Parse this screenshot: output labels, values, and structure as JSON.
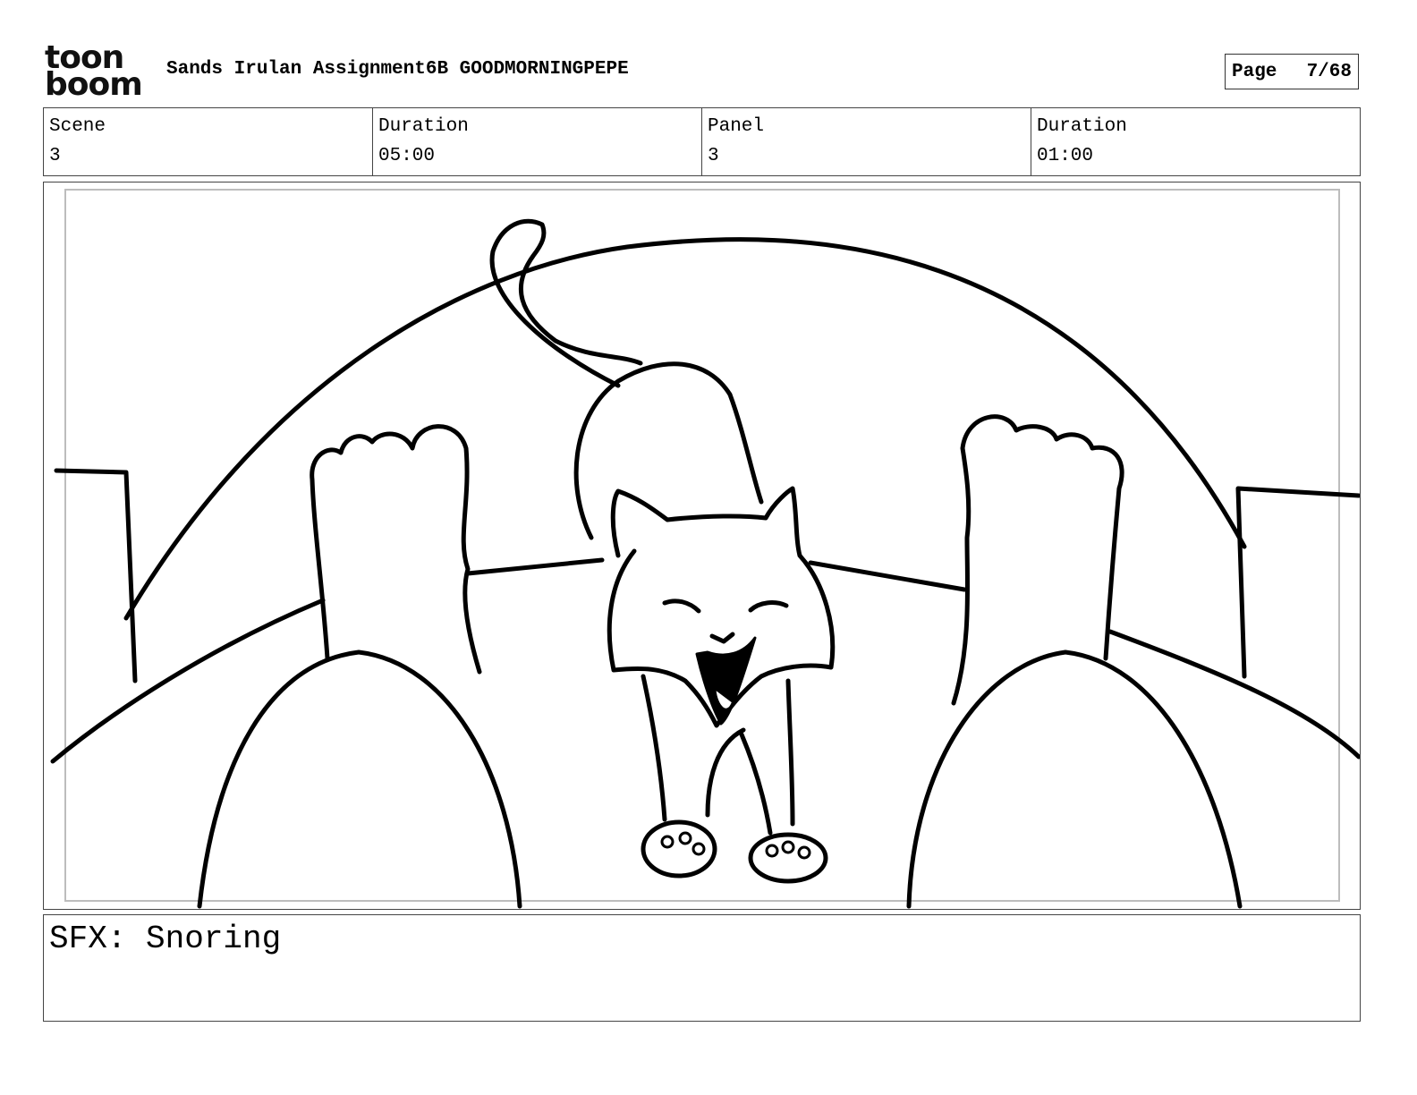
{
  "header": {
    "logo_top": "toon",
    "logo_bottom": "boom",
    "title": "Sands Irulan Assignment6B GOODMORNINGPEPE",
    "page_label": "Page",
    "page_value": "7/68"
  },
  "info": {
    "scene_label": "Scene",
    "scene_value": "3",
    "scene_duration_label": "Duration",
    "scene_duration_value": "05:00",
    "panel_label": "Panel",
    "panel_value": "3",
    "panel_duration_label": "Duration",
    "panel_duration_value": "01:00"
  },
  "notes": {
    "text": "SFX: Snoring"
  }
}
